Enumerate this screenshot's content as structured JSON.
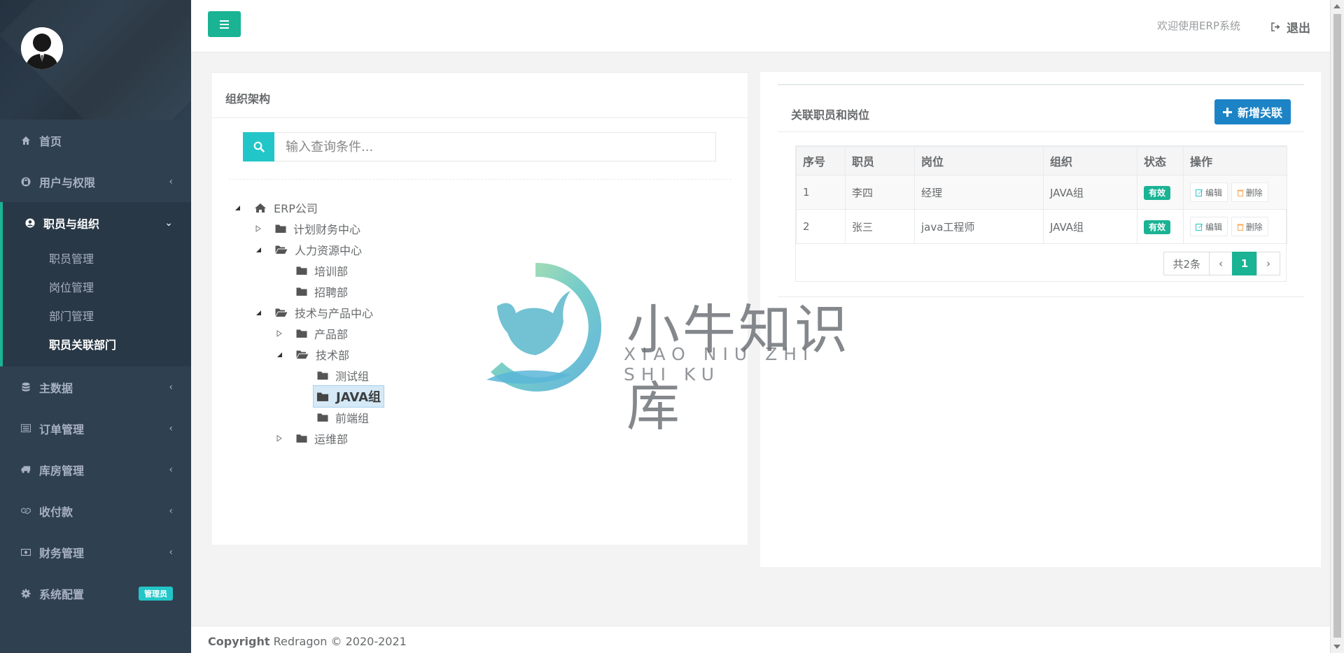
{
  "sidebar": {
    "items": [
      {
        "label": "首页",
        "icon": "home-icon"
      },
      {
        "label": "用户与权限",
        "icon": "lock-icon"
      },
      {
        "label": "职员与组织",
        "icon": "user-circle-icon"
      },
      {
        "label": "主数据",
        "icon": "database-icon"
      },
      {
        "label": "订单管理",
        "icon": "list-alt-icon"
      },
      {
        "label": "库房管理",
        "icon": "truck-icon"
      },
      {
        "label": "收付款",
        "icon": "handshake-icon"
      },
      {
        "label": "财务管理",
        "icon": "money-icon"
      },
      {
        "label": "系统配置",
        "icon": "gear-icon",
        "badge": "管理员"
      }
    ],
    "sub_items": [
      "职员管理",
      "岗位管理",
      "部门管理",
      "职员关联部门"
    ]
  },
  "topbar": {
    "welcome": "欢迎使用ERP系统",
    "logout": "退出"
  },
  "left_panel": {
    "title": "组织架构",
    "search_placeholder": "输入查询条件..."
  },
  "tree": [
    {
      "label": "ERP公司",
      "icon": "home-icon",
      "expanded": true
    },
    {
      "label": "计划财务中心",
      "icon": "folder-icon",
      "expanded": false
    },
    {
      "label": "人力资源中心",
      "icon": "folder-open-icon",
      "expanded": true
    },
    {
      "label": "培训部",
      "icon": "folder-icon"
    },
    {
      "label": "招聘部",
      "icon": "folder-icon"
    },
    {
      "label": "技术与产品中心",
      "icon": "folder-open-icon",
      "expanded": true
    },
    {
      "label": "产品部",
      "icon": "folder-icon",
      "expanded": false
    },
    {
      "label": "技术部",
      "icon": "folder-open-icon",
      "expanded": true
    },
    {
      "label": "测试组",
      "icon": "folder-icon"
    },
    {
      "label": "JAVA组",
      "icon": "folder-icon",
      "selected": true
    },
    {
      "label": "前端组",
      "icon": "folder-icon"
    },
    {
      "label": "运维部",
      "icon": "folder-icon",
      "expanded": false
    }
  ],
  "right_panel": {
    "title": "关联职员和岗位",
    "add_button": "新增关联",
    "columns": [
      "序号",
      "职员",
      "岗位",
      "组织",
      "状态",
      "操作"
    ],
    "rows": [
      {
        "no": "1",
        "employee": "李四",
        "post": "经理",
        "org": "JAVA组",
        "status": "有效",
        "edit": "编辑",
        "delete": "删除"
      },
      {
        "no": "2",
        "employee": "张三",
        "post": "java工程师",
        "org": "JAVA组",
        "status": "有效",
        "edit": "编辑",
        "delete": "删除"
      }
    ],
    "pager": {
      "total": "共2条",
      "current": "1",
      "prev": "‹",
      "next": "›"
    }
  },
  "watermark": {
    "main": "小牛知识库",
    "sub": "XIAO NIU ZHI SHI KU"
  },
  "footer": {
    "copyright_bold": "Copyright",
    "copyright_text": " Redragon © 2020-2021"
  },
  "colors": {
    "sidebar": "#2f4050",
    "primary": "#1ab394",
    "info": "#23c6c8",
    "success_blue": "#1c84c6"
  }
}
